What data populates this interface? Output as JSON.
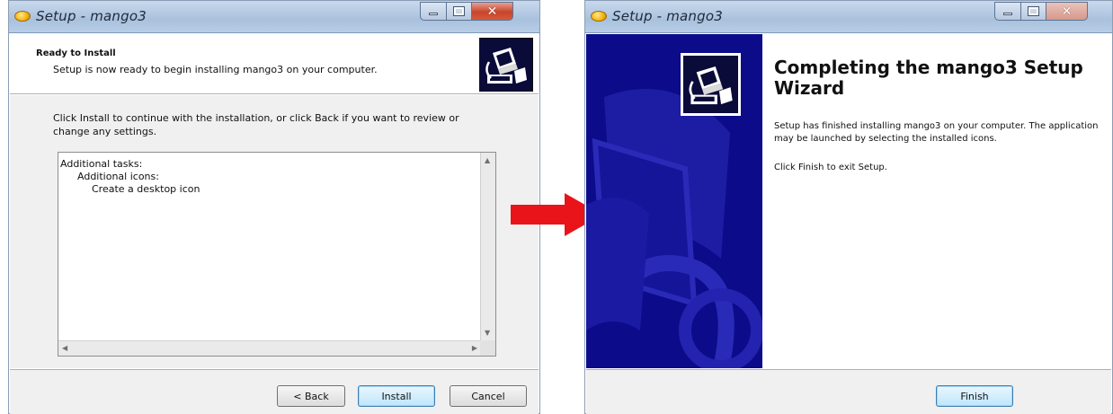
{
  "left_window": {
    "title": "Setup - mango3",
    "header_title": "Ready to Install",
    "header_subtitle": "Setup is now ready to begin installing mango3 on your computer.",
    "intro": "Click Install to continue with the installation, or click Back if you want to review or change any settings.",
    "memo_lines": [
      "Additional tasks:",
      "Additional icons:",
      "Create a desktop icon"
    ],
    "buttons": {
      "back": "< Back",
      "install": "Install",
      "cancel": "Cancel"
    }
  },
  "right_window": {
    "title": "Setup - mango3",
    "heading": "Completing the mango3 Setup Wizard",
    "finished_text": "Setup has finished installing mango3 on your computer. The application may be launched by selecting the installed icons.",
    "exit_text": "Click Finish to exit Setup.",
    "buttons": {
      "finish": "Finish"
    }
  },
  "icons": {
    "app": "mango-app-icon",
    "window_controls": [
      "minimize-icon",
      "maximize-icon",
      "close-icon"
    ],
    "transition": "right-arrow-icon"
  },
  "colors": {
    "banner": "#0c0c8a",
    "arrow": "#e8141a",
    "title_bar": "#b8cde6",
    "default_button": "#3c7fb1",
    "close_button": "#c8442b"
  }
}
